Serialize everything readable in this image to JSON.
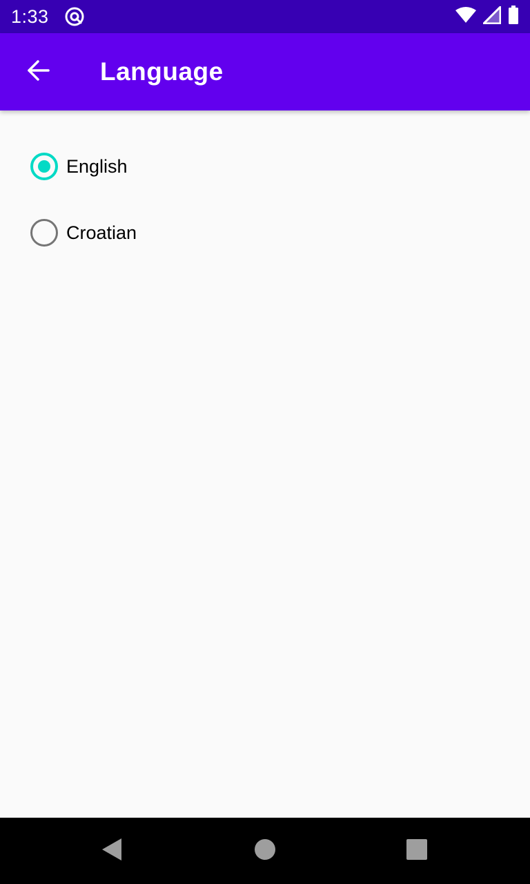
{
  "status_bar": {
    "time": "1:33",
    "icons": [
      "at-sign-icon",
      "wifi-icon",
      "cell-signal-icon",
      "battery-icon"
    ]
  },
  "app_bar": {
    "title": "Language",
    "back_icon": "arrow-back-icon"
  },
  "language_options": [
    {
      "label": "English",
      "selected": true
    },
    {
      "label": "Croatian",
      "selected": false
    }
  ],
  "nav_bar": {
    "icons": [
      "nav-back-icon",
      "nav-home-icon",
      "nav-recents-icon"
    ]
  },
  "colors": {
    "status_bar": "#3700b3",
    "app_bar": "#6200ee",
    "radio_selected": "#03dac5",
    "radio_unselected": "#757575",
    "background": "#fafafa",
    "nav_bar": "#000000"
  }
}
